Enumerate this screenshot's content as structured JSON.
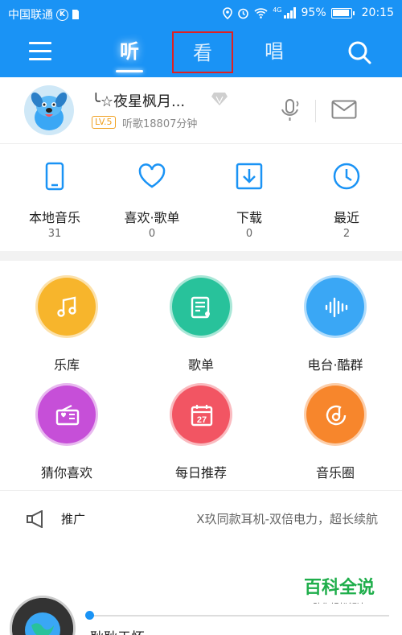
{
  "status_bar": {
    "carrier": "中国联通",
    "carrier_badge": "K",
    "network": "4G",
    "battery": "95%",
    "time": "20:15"
  },
  "nav": {
    "tabs": [
      {
        "label": "听",
        "active": true
      },
      {
        "label": "看",
        "active": false
      },
      {
        "label": "唱",
        "active": false
      }
    ],
    "icons": [
      "menu-icon",
      "search-icon"
    ],
    "highlight_color": "#e02020"
  },
  "profile": {
    "username": "╰☆夜星枫月...",
    "level": "LV.5",
    "listen_time": "听歌18807分钟",
    "icons": [
      "vip-diamond-icon",
      "recognize-song-icon",
      "mail-icon"
    ]
  },
  "stats": [
    {
      "label": "本地音乐",
      "count": "31",
      "icon": "phone-icon"
    },
    {
      "label": "喜欢·歌单",
      "count": "0",
      "icon": "heart-icon"
    },
    {
      "label": "下载",
      "count": "0",
      "icon": "download-icon"
    },
    {
      "label": "最近",
      "count": "2",
      "icon": "clock-icon"
    }
  ],
  "grid": [
    {
      "label": "乐库",
      "color": "#f7b52c",
      "icon": "music-note-icon"
    },
    {
      "label": "歌单",
      "color": "#28c29b",
      "icon": "playlist-icon"
    },
    {
      "label": "电台·酷群",
      "color": "#3aa7f5",
      "icon": "sound-wave-icon"
    },
    {
      "label": "猜你喜欢",
      "color": "#c64fd8",
      "icon": "radio-heart-icon"
    },
    {
      "label": "每日推荐",
      "color": "#f25563",
      "icon": "calendar-icon",
      "day": "27"
    },
    {
      "label": "音乐圈",
      "color": "#f7862c",
      "icon": "music-circle-icon"
    }
  ],
  "promo": {
    "label": "推广",
    "text": "X玖同款耳机-双倍电力，超长续航"
  },
  "watermark": {
    "title": "百科全说",
    "subtitle": "助你轻松解决"
  },
  "player": {
    "song_title": "耿耿于怀",
    "accent_color": "#1a93f5"
  }
}
